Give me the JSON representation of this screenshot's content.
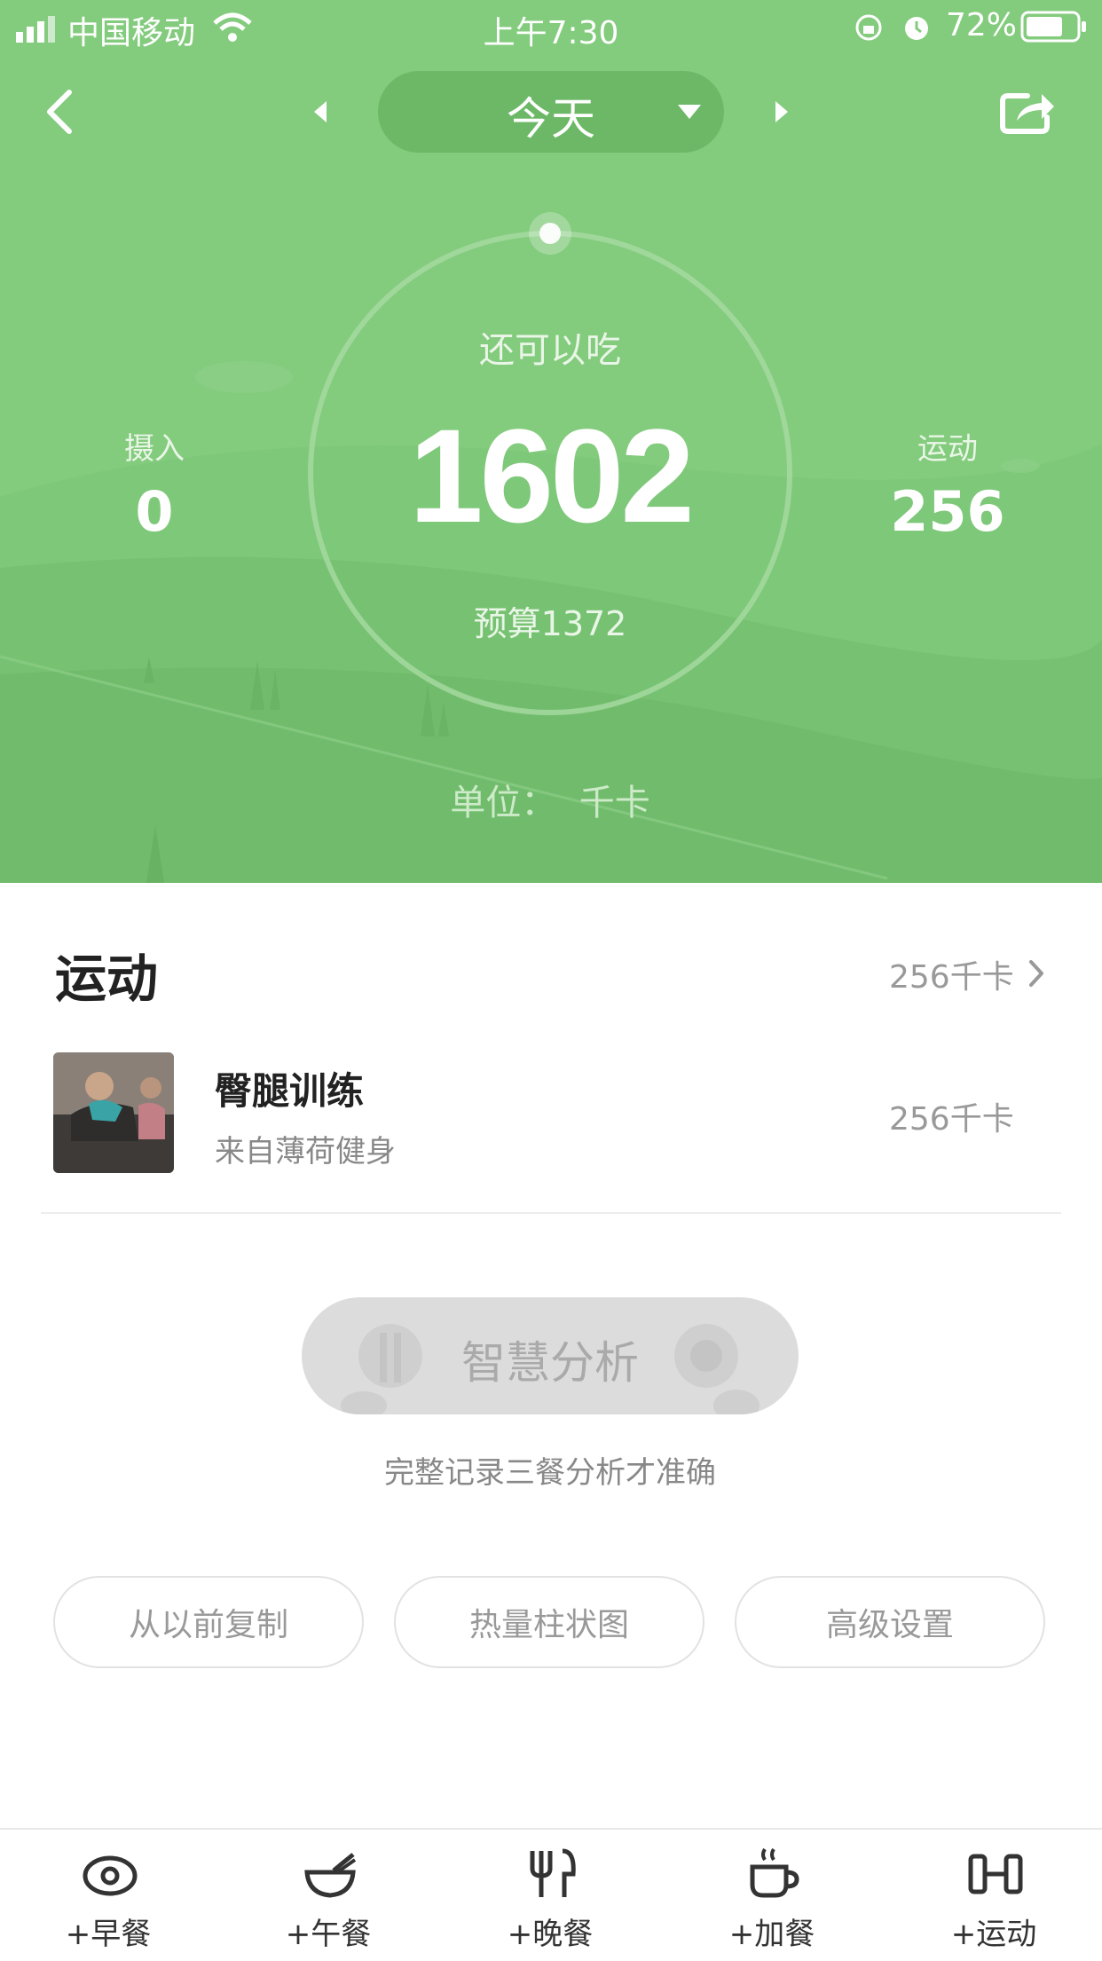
{
  "status_bar": {
    "carrier": "中国移动",
    "time": "上午7:30",
    "battery": "72%"
  },
  "header": {
    "date_label": "今天"
  },
  "summary": {
    "remaining_label": "还可以吃",
    "remaining_value": "1602",
    "budget_label": "预算1372",
    "intake_label": "摄入",
    "intake_value": "0",
    "exercise_label": "运动",
    "exercise_value": "256",
    "unit_label": "单位：  千卡"
  },
  "exercise_section": {
    "title": "运动",
    "total": "256千卡",
    "items": [
      {
        "name": "臀腿训练",
        "source": "来自薄荷健身",
        "calories": "256千卡"
      }
    ]
  },
  "analysis": {
    "button_label": "智慧分析",
    "hint": "完整记录三餐分析才准确"
  },
  "actions": [
    "从以前复制",
    "热量柱状图",
    "高级设置"
  ],
  "tabbar": {
    "items": [
      "+早餐",
      "+午餐",
      "+晚餐",
      "+加餐",
      "+运动"
    ]
  },
  "colors": {
    "hero_green": "#83cb7d",
    "accent": "#7bc46f"
  }
}
